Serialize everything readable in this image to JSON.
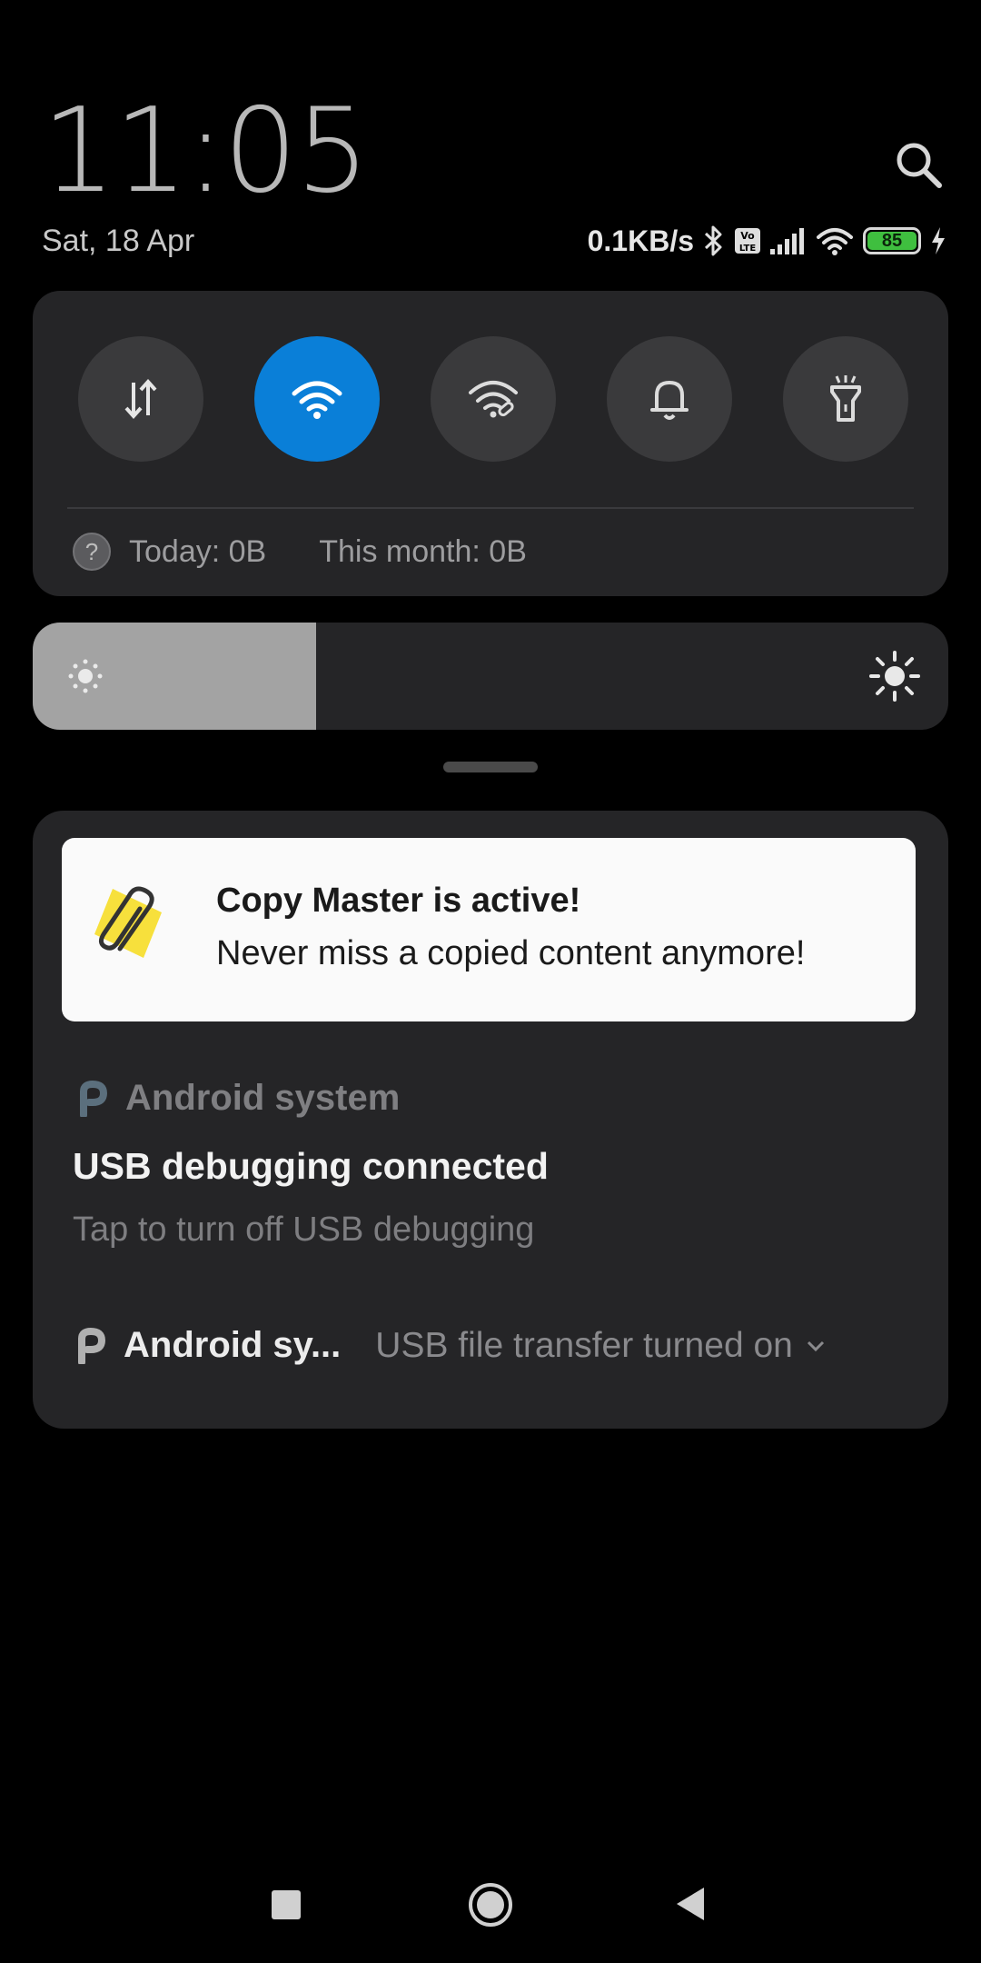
{
  "header": {
    "time": "11:05",
    "date": "Sat, 18 Apr",
    "net_speed": "0.1KB/s",
    "battery": "85",
    "icons": [
      "search-icon",
      "bluetooth-icon",
      "volte-icon",
      "signal-icon",
      "wifi-icon",
      "battery-icon",
      "charging-icon"
    ]
  },
  "quick_settings": {
    "tiles": [
      {
        "name": "mobile-data",
        "icon": "data-transfer-icon",
        "active": false
      },
      {
        "name": "wifi",
        "icon": "wifi-icon",
        "active": true
      },
      {
        "name": "hotspot",
        "icon": "wifi-link-icon",
        "active": false
      },
      {
        "name": "sound",
        "icon": "bell-icon",
        "active": false
      },
      {
        "name": "flashlight",
        "icon": "flashlight-icon",
        "active": false
      }
    ],
    "data_today": "Today: 0B",
    "data_month": "This month: 0B",
    "help_glyph": "?"
  },
  "brightness": {
    "level_fraction": 0.31
  },
  "notifications": {
    "copy_master": {
      "title": "Copy Master is active!",
      "text": "Never miss a copied content anymore!"
    },
    "usb_debugging": {
      "app": "Android system",
      "title": "USB debugging connected",
      "text": "Tap to turn off USB debugging"
    },
    "usb_transfer": {
      "app": "Android sy...",
      "text": "USB file transfer turned on"
    }
  },
  "colors": {
    "accent": "#0a7fd8",
    "panel": "#252527",
    "battery_fill": "#3fbf3f",
    "copy_master_yellow": "#f7e03c"
  }
}
